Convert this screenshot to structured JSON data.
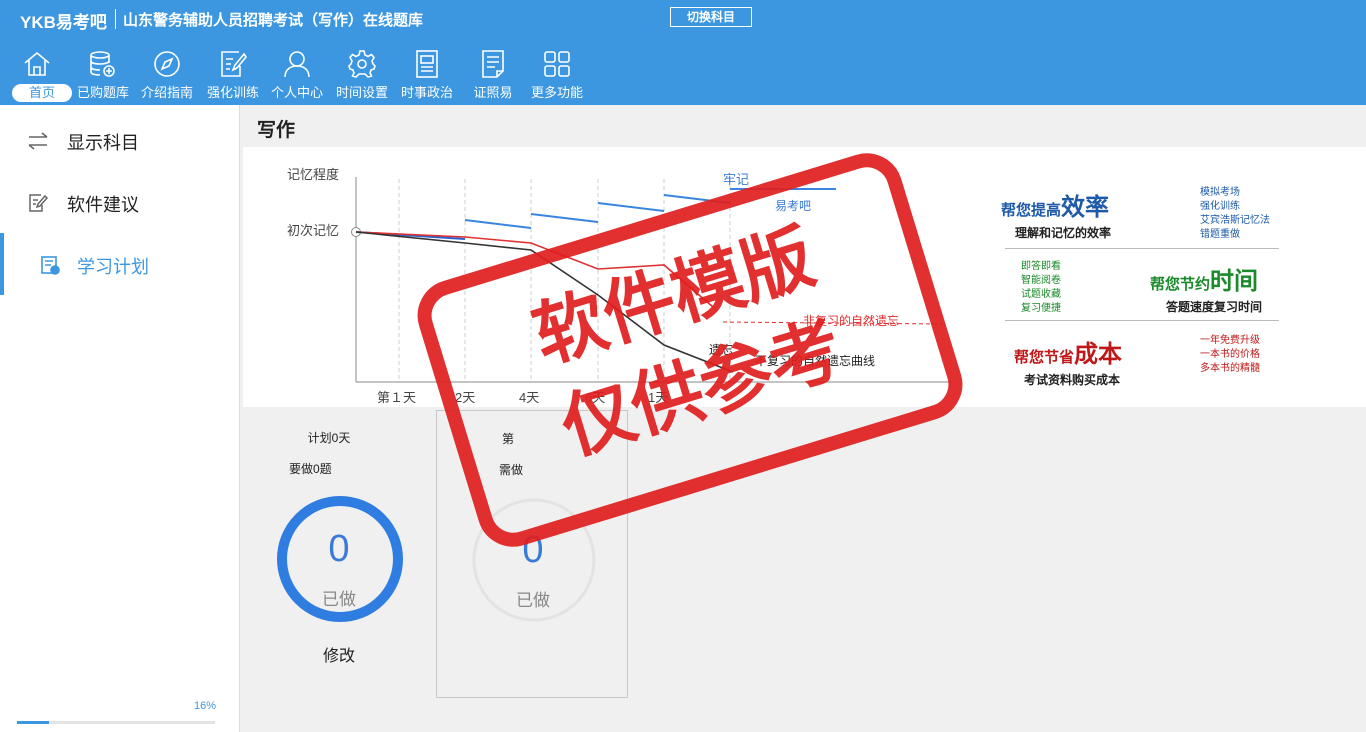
{
  "header": {
    "brand": "YKB易考吧",
    "title": "山东警务辅助人员招聘考试（写作）在线题库",
    "switch_label": "切换科目",
    "nav": [
      {
        "label": "首页",
        "icon": "home-icon"
      },
      {
        "label": "已购题库",
        "icon": "database-add-icon"
      },
      {
        "label": "介绍指南",
        "icon": "compass-icon"
      },
      {
        "label": "强化训练",
        "icon": "edit-note-icon"
      },
      {
        "label": "个人中心",
        "icon": "user-icon"
      },
      {
        "label": "时间设置",
        "icon": "gear-icon"
      },
      {
        "label": "时事政治",
        "icon": "news-icon"
      },
      {
        "label": "证照易",
        "icon": "checklist-icon"
      },
      {
        "label": "更多功能",
        "icon": "grid-icon"
      }
    ]
  },
  "sidebar": {
    "items": [
      {
        "label": "显示科目",
        "icon": "swap-arrows-icon"
      },
      {
        "label": "软件建议",
        "icon": "feedback-edit-icon"
      },
      {
        "label": "学习计划",
        "icon": "study-plan-icon"
      }
    ],
    "progress_text": "16%",
    "progress": 0.16
  },
  "main": {
    "title": "写作"
  },
  "chart": {
    "y_labels": [
      "记忆程度",
      "初次记忆"
    ],
    "x_labels": [
      "第１天",
      "2天",
      "4天",
      "6天",
      "1天"
    ],
    "labels": {
      "firm": "牢记",
      "easy_forget": "易考吧",
      "natural_forget": "非复习的自然遗忘",
      "forget": "遗忘",
      "no_review": "不复习的自然遗忘曲线"
    }
  },
  "promo": {
    "efficiency": {
      "prefix": "帮您提高",
      "big": "效率",
      "sub": "理解和记忆的效率",
      "list": [
        "模拟考场",
        "强化训练",
        "艾宾浩斯记忆法",
        "错题重做"
      ]
    },
    "time": {
      "prefix": "帮您节约",
      "big": "时间",
      "sub": "答题速度复习时间",
      "list": [
        "即答即看",
        "智能阅卷",
        "试题收藏",
        "复习便捷"
      ]
    },
    "cost": {
      "prefix": "帮您节省",
      "big": "成本",
      "sub": "考试资料购买成本",
      "list": [
        "一年免费升级",
        "一本书的价格",
        "多本书的精髓"
      ]
    }
  },
  "plan": [
    {
      "day": "计划0天",
      "need": "要做0题",
      "count": "0",
      "count_label": "已做",
      "edit": "修改"
    },
    {
      "day": "第",
      "need": "需做",
      "count": "0",
      "count_label": "已做"
    }
  ],
  "stamp": {
    "line1": "软件模版",
    "line2": "仅供参考"
  },
  "colors": {
    "primary": "#3c97e0",
    "ring": "#2f7de1",
    "stamp": "#e01e1e"
  }
}
